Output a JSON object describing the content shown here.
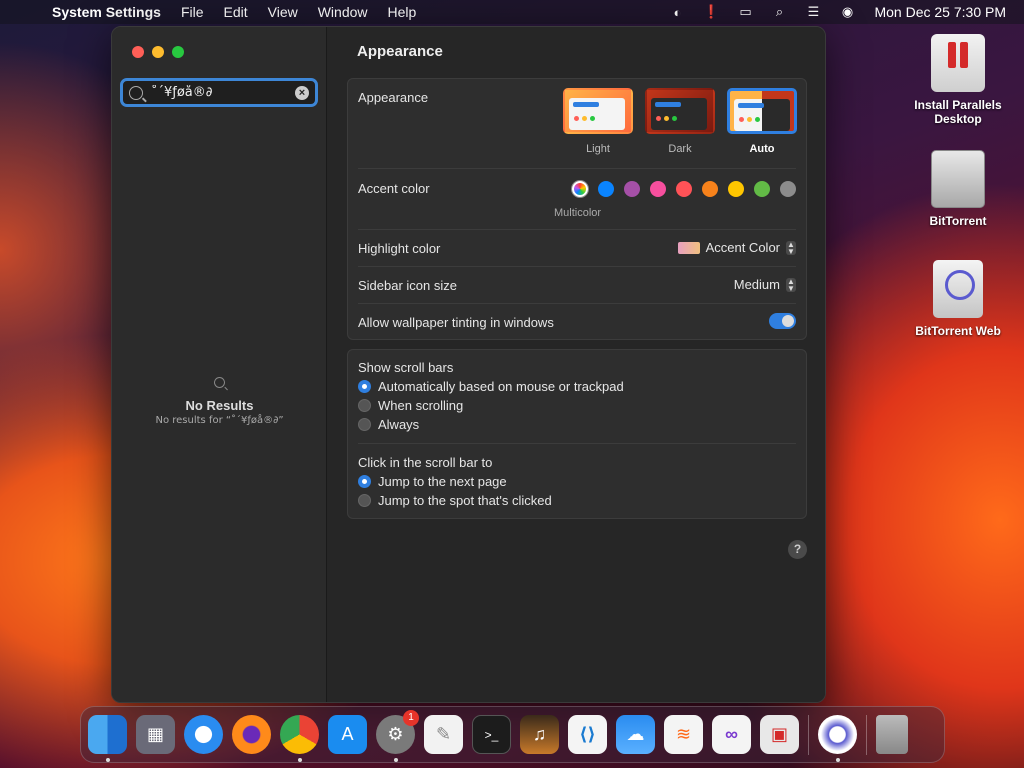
{
  "menubar": {
    "app_name": "System Settings",
    "menus": [
      "File",
      "Edit",
      "View",
      "Window",
      "Help"
    ],
    "clock": "Mon Dec 25  7:30 PM"
  },
  "sidebar": {
    "search_value": "˚´¥ƒøå®∂",
    "no_results_title": "No Results",
    "no_results_detail": "No results for “˚´¥ƒøå®∂”"
  },
  "content": {
    "title": "Appearance",
    "appearance": {
      "label": "Appearance",
      "options": [
        {
          "label": "Light",
          "selected": false
        },
        {
          "label": "Dark",
          "selected": false
        },
        {
          "label": "Auto",
          "selected": true
        }
      ]
    },
    "accent": {
      "label": "Accent color",
      "colors": [
        "#8a8a8a",
        "#0a84ff",
        "#a550a7",
        "#f74f9e",
        "#ff5257",
        "#f7821b",
        "#ffc600",
        "#62ba46",
        "#8c8c8c"
      ],
      "selected_label": "Multicolor"
    },
    "highlight": {
      "label": "Highlight color",
      "value": "Accent Color"
    },
    "sidebar_icon": {
      "label": "Sidebar icon size",
      "value": "Medium"
    },
    "tinting": {
      "label": "Allow wallpaper tinting in windows",
      "on": true
    },
    "scroll_bars": {
      "label": "Show scroll bars",
      "options": [
        {
          "label": "Automatically based on mouse or trackpad",
          "selected": true
        },
        {
          "label": "When scrolling",
          "selected": false
        },
        {
          "label": "Always",
          "selected": false
        }
      ]
    },
    "click_scroll": {
      "label": "Click in the scroll bar to",
      "options": [
        {
          "label": "Jump to the next page",
          "selected": true
        },
        {
          "label": "Jump to the spot that's clicked",
          "selected": false
        }
      ]
    },
    "help": "?"
  },
  "desktop": {
    "icons": [
      {
        "label": "Install Parallels Desktop"
      },
      {
        "label": "BitTorrent"
      },
      {
        "label": "BitTorrent Web"
      }
    ]
  },
  "dock": {
    "settings_badge": "1",
    "items": [
      "finder-icon",
      "launchpad-icon",
      "safari-icon",
      "firefox-icon",
      "chrome-icon",
      "app-store-icon",
      "system-settings-icon",
      "textedit-icon",
      "terminal-icon",
      "garageband-icon",
      "vscode-icon",
      "weather-icon",
      "sublime-icon",
      "visual-studio-icon",
      "remote-desktop-icon",
      "bittorrent-web-icon",
      "trash-icon"
    ]
  }
}
